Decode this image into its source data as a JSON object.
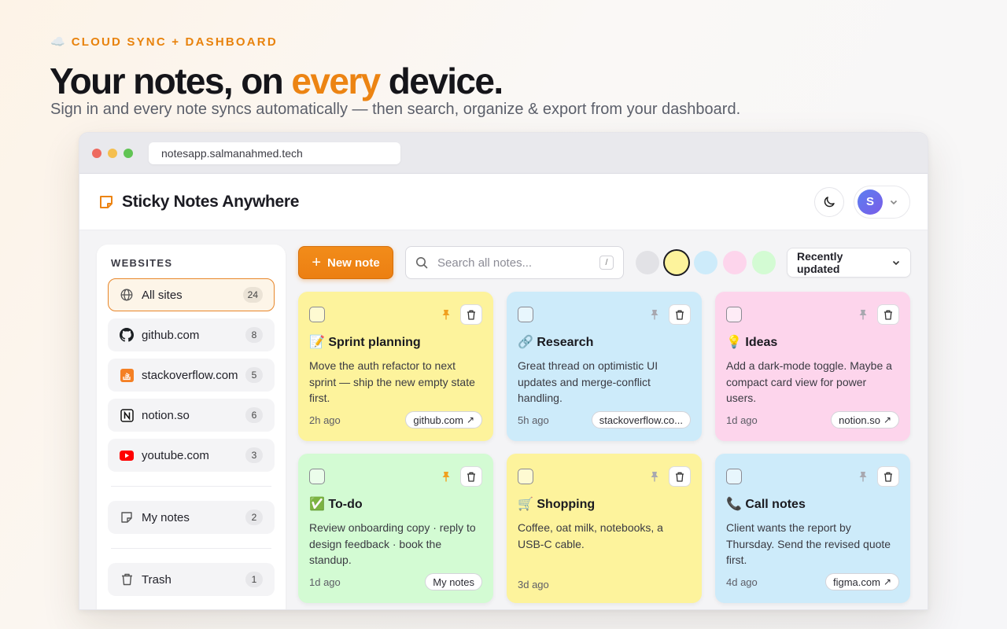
{
  "hero": {
    "eyebrow_icon": "☁️",
    "eyebrow": "CLOUD SYNC + DASHBOARD",
    "headline_pre": "Your notes, on ",
    "headline_accent": "every",
    "headline_post": " device.",
    "subhead": "Sign in and every note syncs automatically — then search, organize & export from your dashboard."
  },
  "browser": {
    "url": "notesapp.salmanahmed.tech"
  },
  "app": {
    "title": "Sticky Notes Anywhere",
    "avatar_initial": "S"
  },
  "sidebar": {
    "heading": "WEBSITES",
    "sites": [
      {
        "label": "All sites",
        "count": "24",
        "icon": "globe-icon"
      },
      {
        "label": "github.com",
        "count": "8",
        "icon": "github-icon"
      },
      {
        "label": "stackoverflow.com",
        "count": "5",
        "icon": "stackoverflow-icon"
      },
      {
        "label": "notion.so",
        "count": "6",
        "icon": "notion-icon"
      },
      {
        "label": "youtube.com",
        "count": "3",
        "icon": "youtube-icon"
      }
    ],
    "my_notes": {
      "label": "My notes",
      "count": "2"
    },
    "trash": {
      "label": "Trash",
      "count": "1"
    }
  },
  "toolbar": {
    "new_note": "New note",
    "search_placeholder": "Search all notes...",
    "search_shortcut": "/",
    "swatches": [
      "#e2e2e6",
      "#fdf39c",
      "#cdebfa",
      "#fdd5ec",
      "#d3fbd3"
    ],
    "selected_swatch": 1,
    "sort_label": "Recently updated"
  },
  "colors": {
    "accent": "#ec8413",
    "pin_active": "#f0a020",
    "pin_inactive": "#a8a8b0"
  },
  "notes": [
    {
      "emoji": "📝",
      "title": "Sprint planning",
      "body": "Move the auth refactor to next sprint — ship the new empty state first.",
      "time": "2h ago",
      "tag": "github.com",
      "tag_link": true,
      "color": "yellow",
      "pinned": true
    },
    {
      "emoji": "🔗",
      "title": "Research",
      "body": "Great thread on optimistic UI updates and merge-conflict handling.",
      "time": "5h ago",
      "tag": "stackoverflow.co...",
      "tag_link": false,
      "color": "blue",
      "pinned": false
    },
    {
      "emoji": "💡",
      "title": "Ideas",
      "body": "Add a dark-mode toggle. Maybe a compact card view for power users.",
      "time": "1d ago",
      "tag": "notion.so",
      "tag_link": true,
      "color": "pink",
      "pinned": false
    },
    {
      "emoji": "✅",
      "title": "To-do",
      "body": "Review onboarding copy · reply to design feedback · book the standup.",
      "time": "1d ago",
      "tag": "My notes",
      "tag_link": false,
      "color": "green",
      "pinned": true
    },
    {
      "emoji": "🛒",
      "title": "Shopping",
      "body": "Coffee, oat milk, notebooks, a USB-C cable.",
      "time": "3d ago",
      "tag": "",
      "tag_link": false,
      "color": "yellow",
      "pinned": false
    },
    {
      "emoji": "📞",
      "title": "Call notes",
      "body": "Client wants the report by Thursday. Send the revised quote first.",
      "time": "4d ago",
      "tag": "figma.com",
      "tag_link": true,
      "color": "blue",
      "pinned": false
    }
  ]
}
